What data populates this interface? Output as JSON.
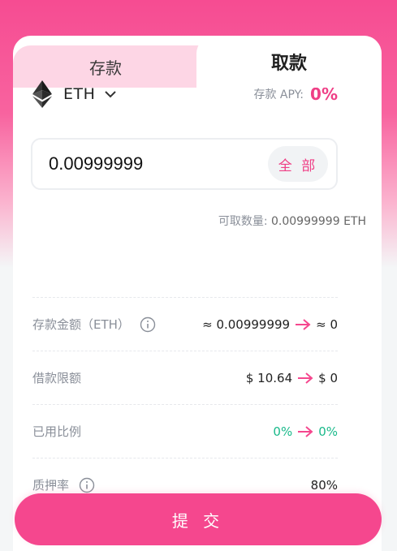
{
  "tabs": {
    "deposit": "存款",
    "withdraw": "取款",
    "active": "withdraw"
  },
  "asset": {
    "name": "ETH",
    "icon": "ethereum-icon"
  },
  "apy": {
    "label": "存款 APY:",
    "value": "0%"
  },
  "amount": {
    "value": "0.00999999",
    "max_label": "全 部"
  },
  "available": {
    "label": "可取数量:",
    "value": "0.00999999 ETH"
  },
  "rows": [
    {
      "label": "存款金额（ETH）",
      "has_info": true,
      "from": "≈ 0.00999999",
      "to": "≈ 0"
    },
    {
      "label": "借款限额",
      "has_info": false,
      "from": "$ 10.64",
      "to": "$ 0"
    },
    {
      "label": "已用比例",
      "has_info": false,
      "from": "0%",
      "to": "0%"
    },
    {
      "label": "质押率",
      "has_info": true,
      "value": "80%"
    }
  ],
  "submit_label": "提 交",
  "colors": {
    "accent": "#f5478e",
    "green": "#19b98a",
    "tab_inactive": "#fdd6e5"
  }
}
